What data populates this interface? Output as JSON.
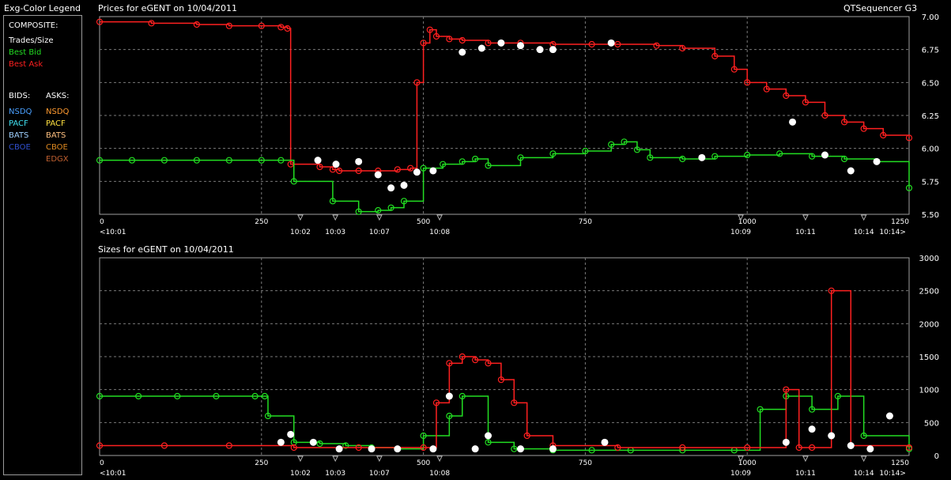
{
  "header": {
    "legend_title": "Exg-Color Legend",
    "app_title": "QTSequencer G3"
  },
  "legend": {
    "composite_title": "COMPOSITE:",
    "composite": [
      {
        "label": "Trades/Size",
        "color": "#ffffff"
      },
      {
        "label": "Best Bid",
        "color": "#22dd22"
      },
      {
        "label": "Best Ask",
        "color": "#ff2020"
      }
    ],
    "bids_title": "BIDS:",
    "asks_title": "ASKS:",
    "bids": [
      {
        "label": "NSDQ",
        "color": "#4aa0ff"
      },
      {
        "label": "PACF",
        "color": "#40e0f0"
      },
      {
        "label": "BATS",
        "color": "#9fd0ff"
      },
      {
        "label": "CBOE",
        "color": "#3050d0"
      }
    ],
    "asks": [
      {
        "label": "NSDQ",
        "color": "#ff9a30"
      },
      {
        "label": "PACF",
        "color": "#ffe040"
      },
      {
        "label": "BATS",
        "color": "#ffc080"
      },
      {
        "label": "CBOE",
        "color": "#e08a20"
      },
      {
        "label": "EDGX",
        "color": "#c06030"
      }
    ]
  },
  "chart_data": [
    {
      "type": "line",
      "title": "Prices for  eGENT  on  10/04/2011",
      "xlim": [
        0,
        1250
      ],
      "ylim": [
        5.5,
        7.0
      ],
      "yticks": [
        "5.50",
        "5.75",
        "6.00",
        "6.25",
        "6.50",
        "6.75",
        "7.00"
      ],
      "xticks": [
        {
          "v": 0,
          "label": "0"
        },
        {
          "v": 250,
          "label": "250"
        },
        {
          "v": 500,
          "label": "500"
        },
        {
          "v": 750,
          "label": "750"
        },
        {
          "v": 1000,
          "label": "1000"
        },
        {
          "v": 1250,
          "label": "1250"
        }
      ],
      "time_labels": [
        {
          "v": 0,
          "label": "<10:01"
        },
        {
          "v": 310,
          "label": "10:02"
        },
        {
          "v": 364,
          "label": "10:03"
        },
        {
          "v": 432,
          "label": "10:07"
        },
        {
          "v": 525,
          "label": "10:08"
        },
        {
          "v": 990,
          "label": "10:09"
        },
        {
          "v": 1090,
          "label": "10:11"
        },
        {
          "v": 1180,
          "label": "10:14"
        },
        {
          "v": 1245,
          "label": "10:14>"
        }
      ],
      "grid": true,
      "series": [
        {
          "name": "Best Ask",
          "color": "#ff2020",
          "x": [
            0,
            80,
            150,
            200,
            250,
            280,
            290,
            295,
            340,
            360,
            370,
            400,
            430,
            460,
            480,
            490,
            500,
            510,
            520,
            540,
            560,
            600,
            650,
            700,
            760,
            800,
            860,
            900,
            950,
            980,
            1000,
            1030,
            1060,
            1090,
            1120,
            1150,
            1180,
            1210,
            1250
          ],
          "y": [
            6.96,
            6.95,
            6.94,
            6.93,
            6.93,
            6.92,
            6.91,
            5.88,
            5.86,
            5.84,
            5.83,
            5.83,
            5.83,
            5.84,
            5.85,
            6.5,
            6.8,
            6.9,
            6.85,
            6.83,
            6.82,
            6.8,
            6.8,
            6.79,
            6.79,
            6.79,
            6.78,
            6.76,
            6.7,
            6.6,
            6.5,
            6.45,
            6.4,
            6.35,
            6.25,
            6.2,
            6.15,
            6.1,
            6.08
          ]
        },
        {
          "name": "Best Bid",
          "color": "#22dd22",
          "x": [
            0,
            50,
            100,
            150,
            200,
            250,
            280,
            300,
            360,
            400,
            430,
            450,
            470,
            500,
            530,
            560,
            580,
            600,
            650,
            700,
            750,
            790,
            810,
            830,
            850,
            900,
            950,
            1000,
            1050,
            1100,
            1150,
            1200,
            1250
          ],
          "y": [
            5.91,
            5.91,
            5.91,
            5.91,
            5.91,
            5.91,
            5.91,
            5.75,
            5.6,
            5.52,
            5.53,
            5.55,
            5.6,
            5.85,
            5.88,
            5.9,
            5.92,
            5.87,
            5.93,
            5.96,
            5.98,
            6.03,
            6.05,
            5.99,
            5.93,
            5.92,
            5.94,
            5.95,
            5.96,
            5.94,
            5.92,
            5.9,
            5.7
          ]
        }
      ],
      "trades": [
        {
          "x": 0.32,
          "y": 5.9
        },
        {
          "x": 337,
          "y": 5.91
        },
        {
          "x": 365,
          "y": 5.88
        },
        {
          "x": 430,
          "y": 5.8
        },
        {
          "x": 450,
          "y": 5.7
        },
        {
          "x": 470,
          "y": 5.72
        },
        {
          "x": 490,
          "y": 5.82
        },
        {
          "x": 515,
          "y": 5.83
        },
        {
          "x": 560,
          "y": 6.73
        },
        {
          "x": 590,
          "y": 6.76
        },
        {
          "x": 620,
          "y": 6.8
        },
        {
          "x": 650,
          "y": 6.78
        },
        {
          "x": 680,
          "y": 6.75
        },
        {
          "x": 700,
          "y": 6.75
        },
        {
          "x": 790,
          "y": 6.8
        },
        {
          "x": 930,
          "y": 5.93
        },
        {
          "x": 1070,
          "y": 6.2
        },
        {
          "x": 1120,
          "y": 5.95
        },
        {
          "x": 1160,
          "y": 5.83
        },
        {
          "x": 1200,
          "y": 5.9
        }
      ]
    },
    {
      "type": "line",
      "title": "Sizes for  eGENT  on  10/04/2011",
      "xlim": [
        0,
        1250
      ],
      "ylim": [
        0,
        3000
      ],
      "yticks": [
        "0",
        "500",
        "1000",
        "1500",
        "2000",
        "2500",
        "3000"
      ],
      "xticks": [
        {
          "v": 0,
          "label": "0"
        },
        {
          "v": 250,
          "label": "250"
        },
        {
          "v": 500,
          "label": "500"
        },
        {
          "v": 750,
          "label": "750"
        },
        {
          "v": 1000,
          "label": "1000"
        },
        {
          "v": 1250,
          "label": "1250"
        }
      ],
      "time_labels": [
        {
          "v": 0,
          "label": "<10:01"
        },
        {
          "v": 310,
          "label": "10:02"
        },
        {
          "v": 364,
          "label": "10:03"
        },
        {
          "v": 432,
          "label": "10:07"
        },
        {
          "v": 525,
          "label": "10:08"
        },
        {
          "v": 990,
          "label": "10:09"
        },
        {
          "v": 1090,
          "label": "10:11"
        },
        {
          "v": 1180,
          "label": "10:14"
        },
        {
          "v": 1245,
          "label": "10:14>"
        }
      ],
      "grid": true,
      "series": [
        {
          "name": "Best Bid",
          "color": "#22dd22",
          "x": [
            0,
            60,
            120,
            180,
            240,
            255,
            260,
            300,
            340,
            380,
            420,
            460,
            500,
            540,
            560,
            600,
            640,
            700,
            760,
            820,
            900,
            980,
            1020,
            1060,
            1100,
            1140,
            1180,
            1250
          ],
          "y": [
            900,
            900,
            900,
            900,
            900,
            900,
            600,
            200,
            180,
            150,
            120,
            100,
            300,
            600,
            900,
            200,
            100,
            80,
            80,
            80,
            80,
            80,
            700,
            900,
            700,
            900,
            300,
            100
          ]
        },
        {
          "name": "Best Ask",
          "color": "#ff2020",
          "x": [
            0,
            100,
            200,
            300,
            400,
            500,
            520,
            540,
            560,
            580,
            600,
            620,
            640,
            660,
            700,
            800,
            900,
            1000,
            1060,
            1080,
            1100,
            1130,
            1160,
            1250
          ],
          "y": [
            150,
            150,
            150,
            120,
            120,
            120,
            800,
            1400,
            1500,
            1450,
            1400,
            1150,
            800,
            300,
            150,
            120,
            120,
            120,
            1000,
            120,
            120,
            2500,
            150,
            120
          ]
        }
      ],
      "trades": [
        {
          "x": 280,
          "y": 200
        },
        {
          "x": 295,
          "y": 320
        },
        {
          "x": 330,
          "y": 200
        },
        {
          "x": 370,
          "y": 100
        },
        {
          "x": 420,
          "y": 100
        },
        {
          "x": 460,
          "y": 100
        },
        {
          "x": 515,
          "y": 100
        },
        {
          "x": 540,
          "y": 900
        },
        {
          "x": 580,
          "y": 100
        },
        {
          "x": 600,
          "y": 300
        },
        {
          "x": 650,
          "y": 100
        },
        {
          "x": 700,
          "y": 100
        },
        {
          "x": 780,
          "y": 200
        },
        {
          "x": 1060,
          "y": 200
        },
        {
          "x": 1100,
          "y": 400
        },
        {
          "x": 1130,
          "y": 300
        },
        {
          "x": 1160,
          "y": 150
        },
        {
          "x": 1190,
          "y": 100
        },
        {
          "x": 1220,
          "y": 600
        }
      ]
    }
  ]
}
